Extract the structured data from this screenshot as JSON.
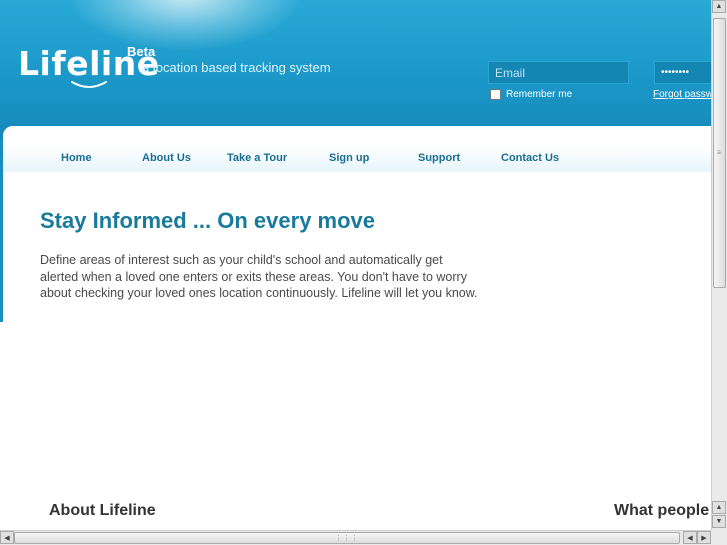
{
  "header": {
    "logo_text": "Lifeline",
    "beta": "Beta",
    "tagline": "a location based tracking system",
    "login": {
      "email_placeholder": "Email",
      "password_value": "password",
      "remember_label": "Remember me",
      "forgot_label": "Forgot password"
    }
  },
  "nav": {
    "items": [
      {
        "label": "Home"
      },
      {
        "label": "About Us"
      },
      {
        "label": "Take a Tour"
      },
      {
        "label": "Sign up"
      },
      {
        "label": "Support"
      },
      {
        "label": "Contact Us"
      }
    ]
  },
  "main": {
    "headline": "Stay Informed ... On every move",
    "intro": "Define areas of interest such as your child's school and automatically get alerted when a loved one enters or exits these areas. You don't have to worry about checking your loved ones location continuously. Lifeline will let you know.",
    "about_heading": "About Lifeline",
    "people_heading": "What people"
  },
  "colors": {
    "header_blue": "#1b98c8",
    "heading_teal": "#1a7a9c",
    "nav_text": "#1a6d93"
  }
}
